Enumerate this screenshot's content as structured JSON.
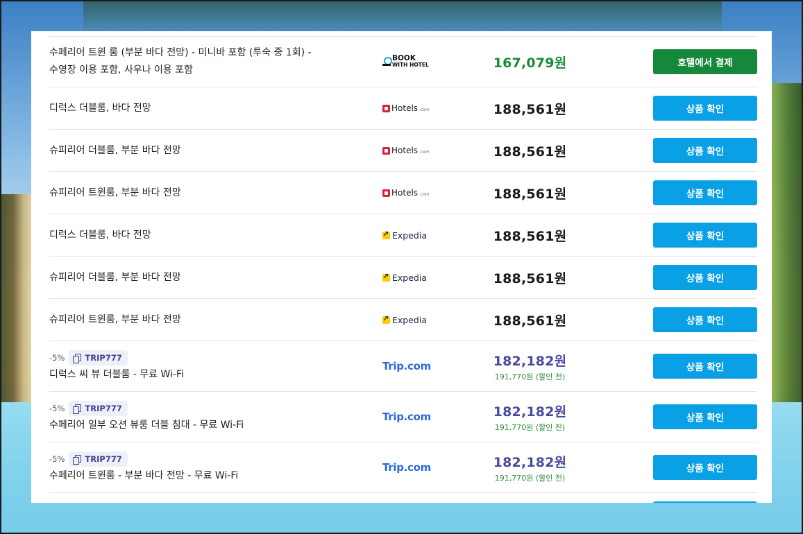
{
  "offers": [
    {
      "name_line1": "수페리어 트윈 룸 (부분 바다 전망) - 미니바 포함 (투숙 중 1회) -",
      "name_line2": "수영장 이용 포함, 사우나 이용 포함",
      "provider": "bookwithhotel",
      "provider_label": "BOOK",
      "provider_label2": "WITH HOTEL",
      "price": "167,079원",
      "price_color": "#1a8a3c",
      "button": "호텔에서 결제",
      "button_color": "#16883c"
    },
    {
      "name": "디럭스 더블룸, 바다 전망",
      "provider": "hotels",
      "provider_label": "Hotels",
      "provider_suffix": ".com",
      "price": "188,561원",
      "button": "상품 확인"
    },
    {
      "name": "슈피리어 더블룸, 부분 바다 전망",
      "provider": "hotels",
      "provider_label": "Hotels",
      "provider_suffix": ".com",
      "price": "188,561원",
      "button": "상품 확인"
    },
    {
      "name": "슈피리어 트윈룸, 부분 바다 전망",
      "provider": "hotels",
      "provider_label": "Hotels",
      "provider_suffix": ".com",
      "price": "188,561원",
      "button": "상품 확인"
    },
    {
      "name": "디럭스 더블룸, 바다 전망",
      "provider": "expedia",
      "provider_label": "Expedia",
      "price": "188,561원",
      "button": "상품 확인"
    },
    {
      "name": "슈피리어 더블룸, 부분 바다 전망",
      "provider": "expedia",
      "provider_label": "Expedia",
      "price": "188,561원",
      "button": "상품 확인"
    },
    {
      "name": "슈피리어 트윈룸, 부분 바다 전망",
      "provider": "expedia",
      "provider_label": "Expedia",
      "price": "188,561원",
      "button": "상품 확인"
    },
    {
      "discount": "-5%",
      "coupon": "TRIP777",
      "name": "디럭스 씨 뷰 더블룸 - 무료 Wi-Fi",
      "provider": "trip",
      "provider_label": "Trip.com",
      "price": "182,182원",
      "original_price": "191,770원 (할인 전)",
      "button": "상품 확인"
    },
    {
      "discount": "-5%",
      "coupon": "TRIP777",
      "name": "수페리어 일부 오션 뷰룸 더블 침대 - 무료 Wi-Fi",
      "provider": "trip",
      "provider_label": "Trip.com",
      "price": "182,182원",
      "original_price": "191,770원 (할인 전)",
      "button": "상품 확인"
    },
    {
      "discount": "-5%",
      "coupon": "TRIP777",
      "name": "수페리어 트윈룸 - 부분 바다 전망 - 무료 Wi-Fi",
      "provider": "trip",
      "provider_label": "Trip.com",
      "price": "182,182원",
      "original_price": "191,770원 (할인 전)",
      "button": "상품 확인"
    }
  ],
  "colors": {
    "primary_button": "#0aa0e6",
    "pay_at_hotel_button": "#16883c",
    "discount_price": "#4a4aa0"
  }
}
